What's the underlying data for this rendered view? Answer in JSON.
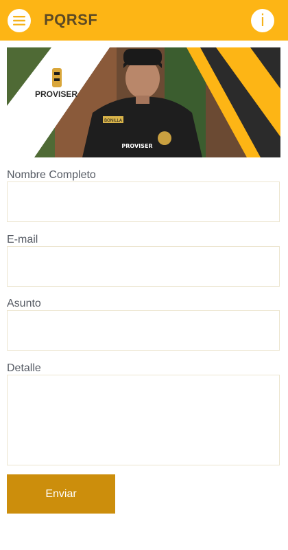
{
  "header": {
    "title": "PQRSF",
    "menu_icon": "hamburger-menu-icon",
    "info_icon": "info-icon",
    "info_glyph": "i"
  },
  "banner": {
    "brand_text": "PROVISER",
    "vest_text": "PROVISER",
    "badge_text": "BONILLA"
  },
  "form": {
    "fields": [
      {
        "label": "Nombre Completo",
        "value": ""
      },
      {
        "label": "E-mail",
        "value": ""
      },
      {
        "label": "Asunto",
        "value": ""
      },
      {
        "label": "Detalle",
        "value": ""
      }
    ],
    "submit_label": "Enviar"
  },
  "colors": {
    "primary": "#FDB515",
    "button": "#CC8E0C",
    "title_text": "#5d4a24",
    "label_text": "#555a63"
  }
}
